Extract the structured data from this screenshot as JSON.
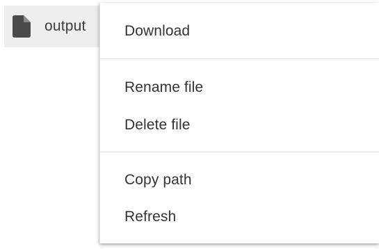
{
  "file": {
    "name": "output"
  },
  "menu": {
    "items": [
      {
        "label": "Download"
      },
      {
        "label": "Rename file"
      },
      {
        "label": "Delete file"
      },
      {
        "label": "Copy path"
      },
      {
        "label": "Refresh"
      }
    ]
  },
  "colors": {
    "row_background": "#eeeeee",
    "icon": "#4a4a4a",
    "text": "#333333",
    "divider": "#e0e0e0"
  },
  "icons": {
    "file": "file-icon"
  }
}
